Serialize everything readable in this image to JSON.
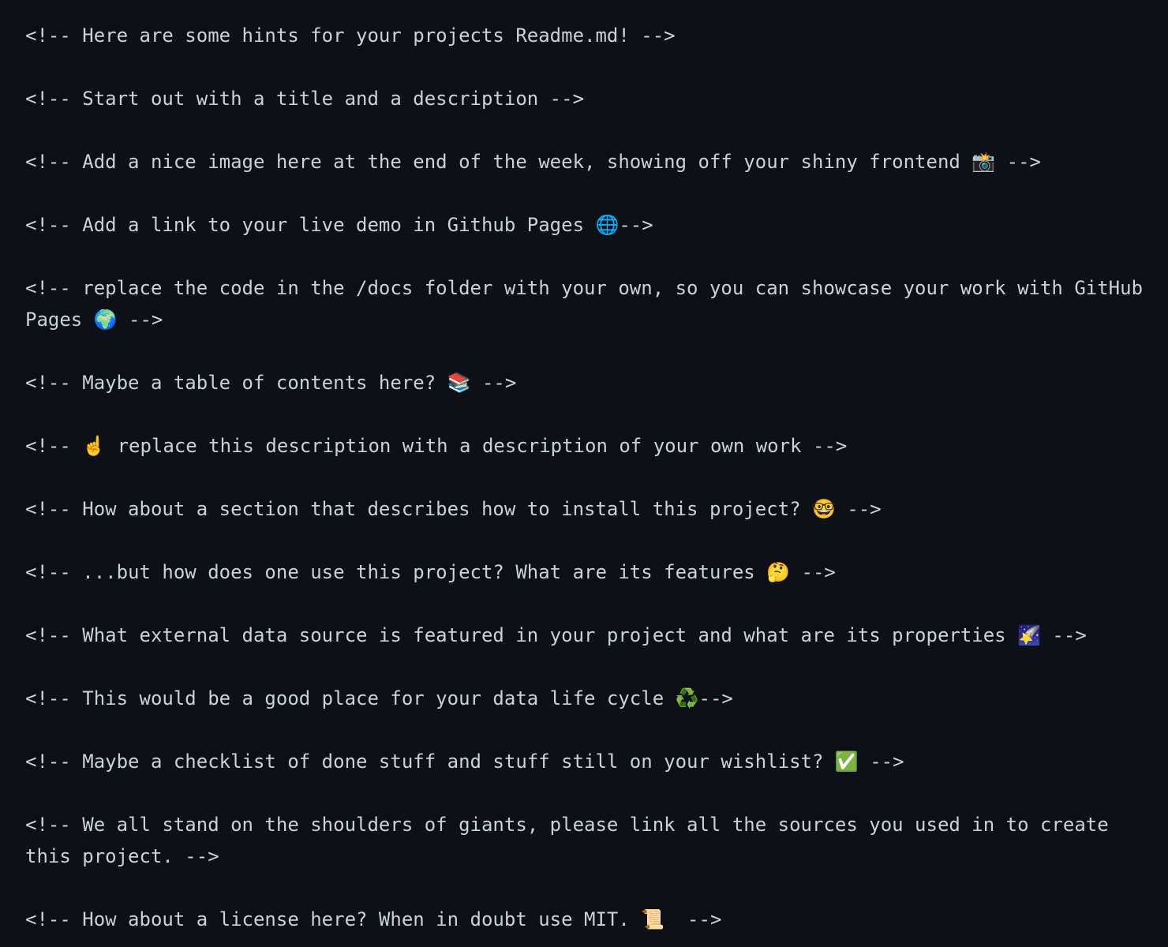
{
  "editor": {
    "background": "#0d1117",
    "text_color": "#c9d1d9"
  },
  "lines": [
    "<!-- Here are some hints for your projects Readme.md! -->",
    "<!-- Start out with a title and a description -->",
    "<!-- Add a nice image here at the end of the week, showing off your shiny frontend 📸 -->",
    "<!-- Add a link to your live demo in Github Pages 🌐-->",
    "<!-- replace the code in the /docs folder with your own, so you can showcase your work with GitHub Pages 🌍 -->",
    "<!-- Maybe a table of contents here? 📚 -->",
    "<!-- ☝️ replace this description with a description of your own work -->",
    "<!-- How about a section that describes how to install this project? 🤓 -->",
    "<!-- ...but how does one use this project? What are its features 🤔 -->",
    "<!-- What external data source is featured in your project and what are its properties 🌠 -->",
    "<!-- This would be a good place for your data life cycle ♻️-->",
    "<!-- Maybe a checklist of done stuff and stuff still on your wishlist? ✅ -->",
    "<!-- We all stand on the shoulders of giants, please link all the sources you used in to create this project. -->",
    "<!-- How about a license here? When in doubt use MIT. 📜  -->"
  ]
}
